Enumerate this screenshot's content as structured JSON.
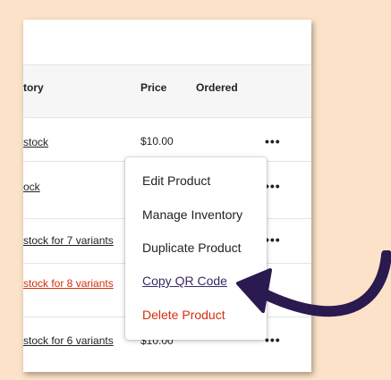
{
  "table": {
    "columns": {
      "inventory": "tory",
      "price": "Price",
      "ordered": "Ordered"
    },
    "rows": [
      {
        "inventory": "stock",
        "price": "$10.00"
      },
      {
        "inventory": "ock",
        "price": ""
      },
      {
        "inventory": "stock for 7 variants",
        "price": ""
      },
      {
        "inventory": "stock for 8 variants",
        "price": ""
      },
      {
        "inventory": "stock for 6 variants",
        "price": "$10.00"
      }
    ],
    "more_actions": "•••"
  },
  "menu": {
    "items": [
      {
        "label": "Edit Product"
      },
      {
        "label": "Manage Inventory"
      },
      {
        "label": "Duplicate Product"
      },
      {
        "label": "Copy QR Code"
      },
      {
        "label": "Delete Product"
      }
    ]
  },
  "colors": {
    "background": "#fbe2c8",
    "danger": "#d82c0d",
    "arrow": "#2b1a4f"
  }
}
